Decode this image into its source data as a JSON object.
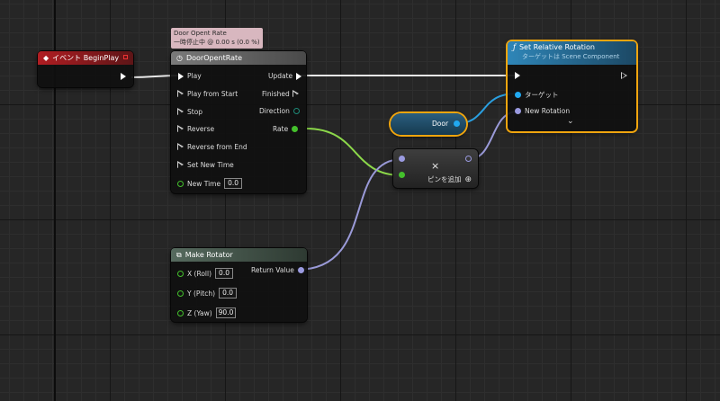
{
  "colors": {
    "exec": "#ffffff",
    "float": "#9fff44",
    "float_pin": "#44c02c",
    "object": "#21a9f1",
    "struct": "#8f8fe0",
    "event_header": "#a3191f",
    "timeline_header": "#6e6e6e",
    "function_header": "#2c6f95",
    "struct_header": "#44564c",
    "selection": "#f0a50e"
  },
  "tooltip": {
    "line1": "Door Opent Rate",
    "line2": "一時停止中 @ 0.00 s (0.0 %)"
  },
  "event_node": {
    "title": "イベント BeginPlay",
    "icon": "event-diamond-icon"
  },
  "timeline_node": {
    "title": "DoorOpentRate",
    "icon": "clock-icon",
    "inputs": [
      "Play",
      "Play from Start",
      "Stop",
      "Reverse",
      "Reverse from End",
      "Set New Time"
    ],
    "new_time_label": "New Time",
    "new_time_value": "0.0",
    "outputs": [
      "Update",
      "Finished",
      "Direction",
      "Rate"
    ]
  },
  "set_rotation_node": {
    "title": "Set Relative Rotation",
    "subtitle": "ターゲットは Scene Component",
    "icon": "function-f-icon",
    "target_label": "ターゲット",
    "new_rotation_label": "New Rotation",
    "expand_glyph": "⌄"
  },
  "door_node": {
    "label": "Door"
  },
  "multiply_node": {
    "symbol": "×",
    "add_pin_label": "ピンを追加",
    "add_pin_icon": "⊕"
  },
  "make_rotator_node": {
    "title": "Make Rotator",
    "icon": "struct-icon",
    "x_label": "X (Roll)",
    "x_value": "0.0",
    "y_label": "Y (Pitch)",
    "y_value": "0.0",
    "z_label": "Z (Yaw)",
    "z_value": "90.0",
    "output_label": "Return Value"
  }
}
